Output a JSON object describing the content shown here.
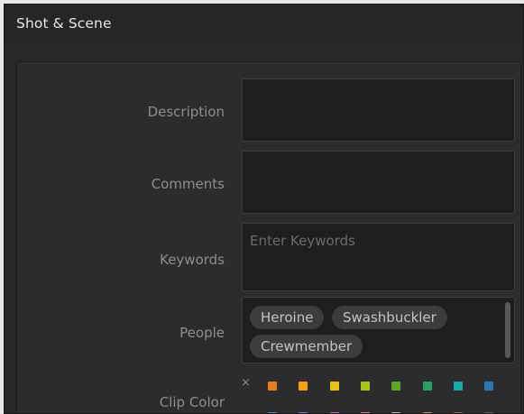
{
  "panel": {
    "title": "Shot & Scene"
  },
  "fields": {
    "description": {
      "label": "Description",
      "value": ""
    },
    "comments": {
      "label": "Comments",
      "value": ""
    },
    "keywords": {
      "label": "Keywords",
      "placeholder": "Enter Keywords",
      "value": ""
    },
    "people": {
      "label": "People",
      "tags": [
        "Heroine",
        "Swashbuckler",
        "Crewmember"
      ]
    },
    "clip_color": {
      "label": "Clip Color",
      "clear_symbol": "×",
      "row1_colors": [
        "#e77e1c",
        "#f2a40f",
        "#e3c21a",
        "#a6c51a",
        "#5ea624",
        "#26a060",
        "#17a8a8",
        "#2d77b5"
      ],
      "row2_colors": [
        "#3a8fd0",
        "#a06ad0",
        "#d062b0",
        "#e07aa0",
        "#c8b49a",
        "#b89468",
        "#8a6a4a",
        "#606060"
      ]
    }
  }
}
